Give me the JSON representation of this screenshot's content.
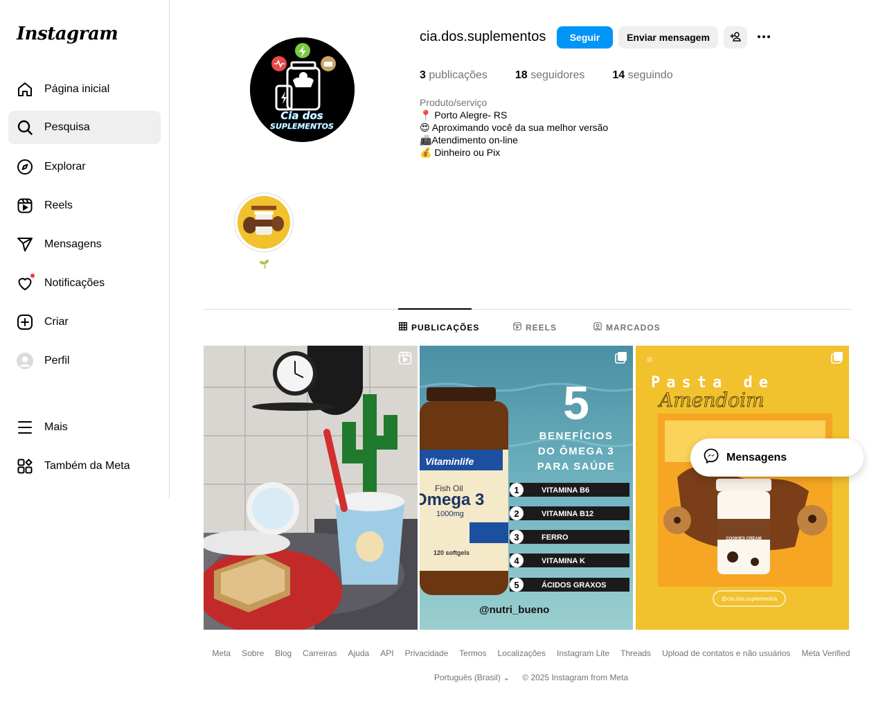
{
  "sidebar": {
    "logo": "Instagram",
    "items": [
      {
        "label": "Página inicial",
        "icon": "home-icon"
      },
      {
        "label": "Pesquisa",
        "icon": "search-icon"
      },
      {
        "label": "Explorar",
        "icon": "compass-icon"
      },
      {
        "label": "Reels",
        "icon": "reels-icon"
      },
      {
        "label": "Mensagens",
        "icon": "send-icon"
      },
      {
        "label": "Notificações",
        "icon": "heart-icon"
      },
      {
        "label": "Criar",
        "icon": "plus-square-icon"
      },
      {
        "label": "Perfil",
        "icon": "profile-avatar-icon"
      },
      {
        "label": "Mais",
        "icon": "menu-icon"
      },
      {
        "label": "Também da Meta",
        "icon": "meta-apps-icon"
      }
    ]
  },
  "profile": {
    "username": "cia.dos.suplementos",
    "logo_text_1": "Cia dos",
    "logo_text_2": "SUPLEMENTOS",
    "follow_label": "Seguir",
    "message_label": "Enviar mensagem",
    "posts_count": "3",
    "posts_label": "publicações",
    "followers_count": "18",
    "followers_label": "seguidores",
    "following_count": "14",
    "following_label": "seguindo",
    "category": "Produto/serviço",
    "bio": [
      "📍 Porto Alegre- RS",
      "😍 Aproximando você da sua melhor versão",
      "📠Atendimento on-line",
      "💰 Dinheiro ou Pix"
    ]
  },
  "highlight": {
    "label": "🌱"
  },
  "tabs": [
    {
      "label": "PUBLICAÇÕES"
    },
    {
      "label": "REELS"
    },
    {
      "label": "MARCADOS"
    }
  ],
  "posts": {
    "p2": {
      "big_number": "5",
      "headline": [
        "BENEFÍCIOS",
        "DO ÔMEGA 3",
        "PARA SAÚDE"
      ],
      "brand": "Vitaminlife",
      "product_line1": "Fish Oil",
      "product_line2": "Omega 3",
      "product_dose": "1000mg",
      "product_softgels": "120 softgels",
      "items": [
        {
          "num": "1",
          "text": "VITAMINA B6"
        },
        {
          "num": "2",
          "text": "VITAMINA B12"
        },
        {
          "num": "3",
          "text": "FERRO"
        },
        {
          "num": "4",
          "text": "VITAMINA K"
        },
        {
          "num": "5",
          "text": "ÁCIDOS GRAXOS"
        }
      ],
      "handle": "@nutri_bueno"
    },
    "p3": {
      "title1": "Pasta de",
      "title2": "Amendoim",
      "handle": "@cia.dos.suplementos",
      "jar_label": "COOKIES CREAM"
    }
  },
  "footer": {
    "links": [
      "Meta",
      "Sobre",
      "Blog",
      "Carreiras",
      "Ajuda",
      "API",
      "Privacidade",
      "Termos",
      "Localizações",
      "Instagram Lite",
      "Threads",
      "Upload de contatos e não usuários",
      "Meta Verified"
    ],
    "language": "Português (Brasil)",
    "copyright": "© 2025 Instagram from Meta"
  },
  "messages_float": {
    "label": "Mensagens"
  },
  "colors": {
    "accent": "#0095f6",
    "notif": "#ff3040",
    "post3_bg": "#f2c12e"
  }
}
